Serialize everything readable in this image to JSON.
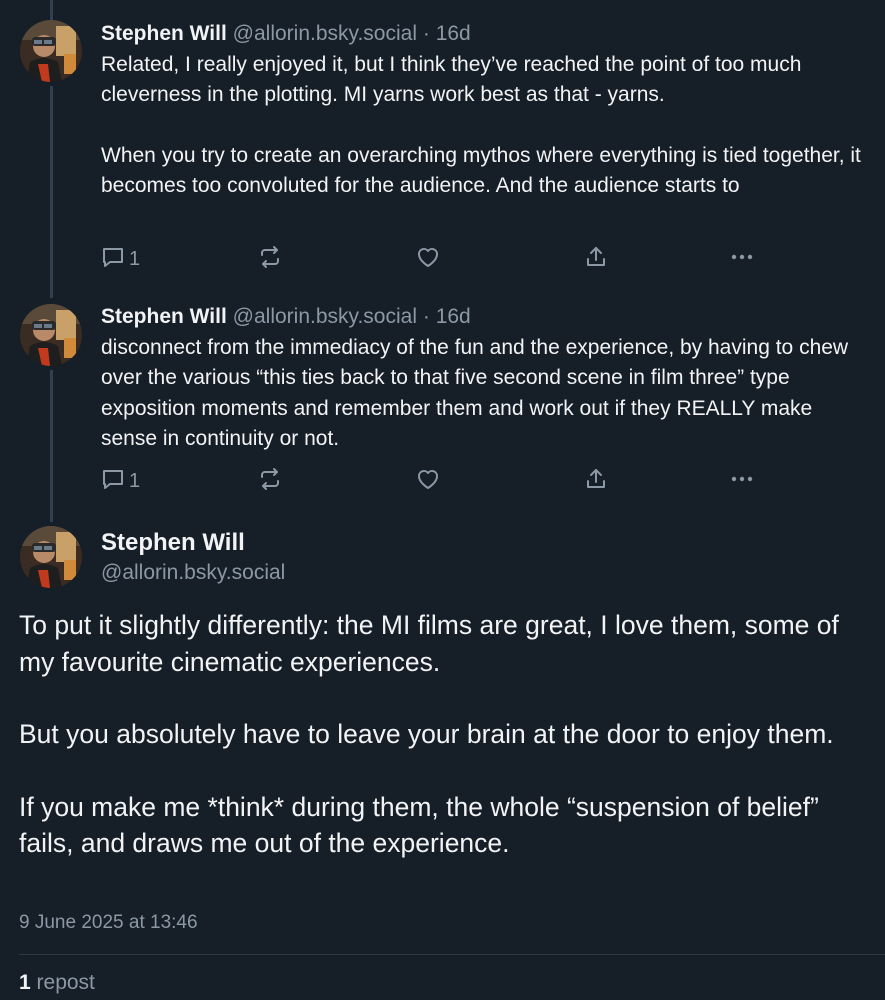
{
  "colors": {
    "background": "#161e27",
    "text_primary": "#f1f3f5",
    "text_secondary": "#8b98a5",
    "thread_line": "#2e4052"
  },
  "replies": [
    {
      "name": "Stephen Will",
      "handle": "@allorin.bsky.social",
      "separator": "·",
      "time": "16d",
      "paragraphs": [
        "Related, I really enjoyed it, but I think they’ve reached the point of too much cleverness in the plotting. MI yarns work best as that - yarns.",
        "When you try to create an overarching mythos where everything is tied together, it becomes too convoluted for the audience. And the audience starts to"
      ],
      "reply_count": "1",
      "icons": [
        "reply-icon",
        "repost-icon",
        "like-icon",
        "share-icon",
        "more-icon"
      ]
    },
    {
      "name": "Stephen Will",
      "handle": "@allorin.bsky.social",
      "separator": "·",
      "time": "16d",
      "paragraphs": [
        "disconnect from the immediacy of the fun and the experience, by having to chew over the various “this ties back to that five second scene in film three” type exposition moments and remember them and work out if they REALLY make sense in continuity or not."
      ],
      "reply_count": "1",
      "icons": [
        "reply-icon",
        "repost-icon",
        "like-icon",
        "share-icon",
        "more-icon"
      ]
    }
  ],
  "main_post": {
    "name": "Stephen Will",
    "handle": "@allorin.bsky.social",
    "paragraphs": [
      "To put it slightly differently: the MI films are great, I love them, some of my favourite cinematic experiences.",
      "But you absolutely have to leave your brain at the door to enjoy them.",
      "If you make me *think* during them, the whole “suspension of belief” fails, and draws me out of the experience."
    ],
    "timestamp": "9 June 2025 at 13:46",
    "repost_count": "1",
    "repost_label": "repost"
  }
}
